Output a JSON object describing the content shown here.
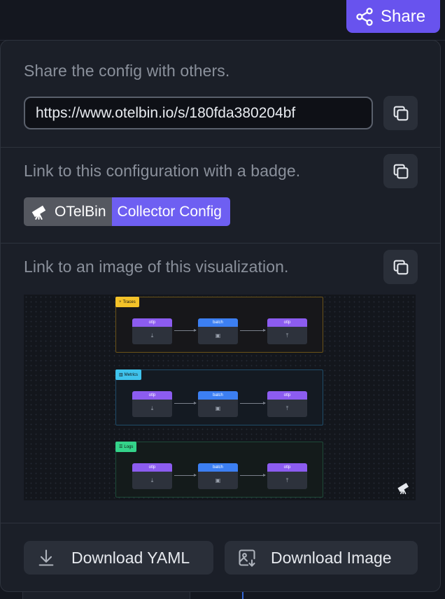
{
  "header": {
    "share_label": "Share"
  },
  "share": {
    "description": "Share the config with others.",
    "url": "https://www.otelbin.io/s/180fda380204bf"
  },
  "badge_section": {
    "description": "Link to this configuration with a badge.",
    "badge_left": "OTelBin",
    "badge_right": "Collector Config"
  },
  "image_section": {
    "description": "Link to an image of this visualization.",
    "pipelines": [
      {
        "tag": "Traces",
        "color": "#f3c229",
        "nodes": [
          "otlp",
          "batch",
          "otlp"
        ]
      },
      {
        "tag": "Metrics",
        "color": "#3fc3ec",
        "nodes": [
          "otlp",
          "batch",
          "otlp"
        ]
      },
      {
        "tag": "Logs",
        "color": "#34d38a",
        "nodes": [
          "otlp",
          "batch",
          "otlp"
        ]
      }
    ]
  },
  "actions": {
    "download_yaml": "Download YAML",
    "download_image": "Download Image"
  },
  "colors": {
    "accent": "#6853ee",
    "panel": "#1b1f28",
    "badge_gray": "#555860",
    "badge_purple": "#6e5ff2"
  },
  "icons": [
    "share-icon",
    "copy-icon",
    "telescope-icon",
    "download-icon",
    "image-download-icon"
  ]
}
